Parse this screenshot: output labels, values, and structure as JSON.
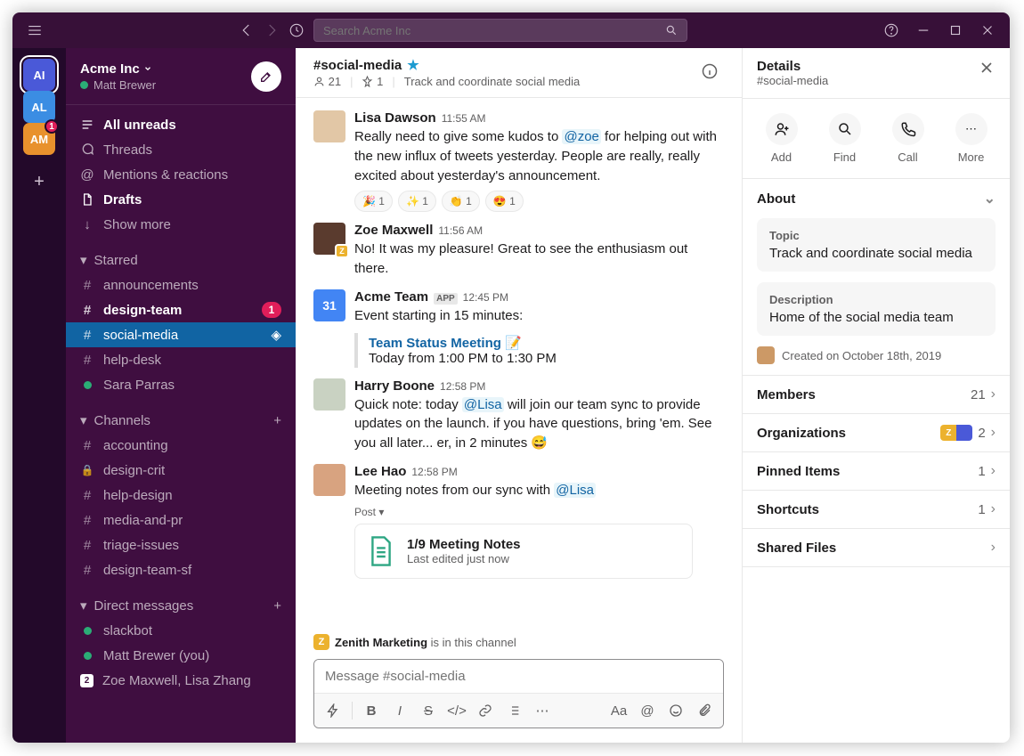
{
  "titlebar": {
    "search_placeholder": "Search Acme Inc"
  },
  "rail": {
    "workspaces": [
      {
        "initials": "AI",
        "color": "#4a59d8",
        "active": true,
        "badge": null
      },
      {
        "initials": "AL",
        "color": "#3b8de3",
        "active": false,
        "badge": null
      },
      {
        "initials": "AM",
        "color": "#e8912d",
        "active": false,
        "badge": "1"
      }
    ]
  },
  "sidebar": {
    "workspace_name": "Acme Inc",
    "user_name": "Matt Brewer",
    "nav": {
      "all_unreads": "All unreads",
      "threads": "Threads",
      "mentions": "Mentions & reactions",
      "drafts": "Drafts",
      "show_more": "Show more"
    },
    "sections": {
      "starred": {
        "label": "Starred",
        "items": [
          {
            "prefix": "#",
            "name": "announcements",
            "bold": false
          },
          {
            "prefix": "#",
            "name": "design-team",
            "bold": true,
            "badge": "1"
          },
          {
            "prefix": "#",
            "name": "social-media",
            "bold": false,
            "selected": true,
            "shared": true
          },
          {
            "prefix": "#",
            "name": "help-desk",
            "bold": false
          },
          {
            "prefix": "presence",
            "name": "Sara Parras",
            "bold": false
          }
        ]
      },
      "channels": {
        "label": "Channels",
        "items": [
          {
            "prefix": "#",
            "name": "accounting"
          },
          {
            "prefix": "lock",
            "name": "design-crit"
          },
          {
            "prefix": "#",
            "name": "help-design"
          },
          {
            "prefix": "#",
            "name": "media-and-pr"
          },
          {
            "prefix": "#",
            "name": "triage-issues"
          },
          {
            "prefix": "#",
            "name": "design-team-sf"
          }
        ]
      },
      "dms": {
        "label": "Direct messages",
        "items": [
          {
            "prefix": "presence",
            "name": "slackbot"
          },
          {
            "prefix": "presence",
            "name": "Matt Brewer (you)"
          },
          {
            "prefix": "count2",
            "name": "Zoe Maxwell, Lisa Zhang"
          }
        ]
      }
    }
  },
  "channel": {
    "name": "#social-media",
    "members": "21",
    "pins": "1",
    "topic": "Track and coordinate social media"
  },
  "messages": [
    {
      "kind": "user",
      "avatar_bg": "#e2c7a6",
      "author": "Lisa Dawson",
      "time": "11:55 AM",
      "text_pre": "Really need to give some kudos to ",
      "mention": "@zoe",
      "text_post": " for helping out with the new influx of tweets yesterday. People are really, really excited about yesterday's announcement.",
      "reactions": [
        {
          "emoji": "🎉",
          "count": "1"
        },
        {
          "emoji": "✨",
          "count": "1"
        },
        {
          "emoji": "👏",
          "count": "1"
        },
        {
          "emoji": "😍",
          "count": "1"
        }
      ]
    },
    {
      "kind": "user",
      "avatar_bg": "#5a3b2e",
      "avatar_badge": "Z",
      "author": "Zoe Maxwell",
      "time": "11:56 AM",
      "text_pre": "No! It was my pleasure! Great to see the enthusiasm out there.",
      "mention": "",
      "text_post": ""
    },
    {
      "kind": "app",
      "author": "Acme Team",
      "time": "12:45 PM",
      "app_label": "APP",
      "text_pre": "Event starting in 15 minutes:",
      "attach_title": "Team Status Meeting 📝",
      "attach_sub": "Today from 1:00 PM to 1:30 PM",
      "cal_day": "31"
    },
    {
      "kind": "user",
      "avatar_bg": "#c9d2c2",
      "author": "Harry Boone",
      "time": "12:58 PM",
      "text_pre": "Quick note: today ",
      "mention": "@Lisa",
      "text_post": " will join our team sync to provide updates on the launch. if you have questions, bring 'em. See you all later... er, in 2 minutes 😅"
    },
    {
      "kind": "file",
      "avatar_bg": "#d8a380",
      "author": "Lee Hao",
      "time": "12:58 PM",
      "text_pre": "Meeting notes from our sync with ",
      "mention": "@Lisa",
      "text_post": "",
      "post_label": "Post ▾",
      "file_name": "1/9 Meeting Notes",
      "file_sub": "Last edited just now"
    }
  ],
  "org_banner": {
    "org": "Zenith Marketing",
    "tail": " is in this channel",
    "tile": "Z"
  },
  "composer": {
    "placeholder": "Message #social-media"
  },
  "details": {
    "title": "Details",
    "channel": "#social-media",
    "actions": {
      "add": "Add",
      "find": "Find",
      "call": "Call",
      "more": "More"
    },
    "about": {
      "label": "About",
      "topic_label": "Topic",
      "topic": "Track and coordinate social media",
      "desc_label": "Description",
      "desc": "Home of the social media team",
      "created": "Created on October 18th, 2019"
    },
    "rows": {
      "members": {
        "label": "Members",
        "count": "21"
      },
      "orgs": {
        "label": "Organizations",
        "count": "2"
      },
      "pinned": {
        "label": "Pinned Items",
        "count": "1"
      },
      "shortcuts": {
        "label": "Shortcuts",
        "count": "1"
      },
      "files": {
        "label": "Shared Files",
        "count": ""
      }
    }
  }
}
